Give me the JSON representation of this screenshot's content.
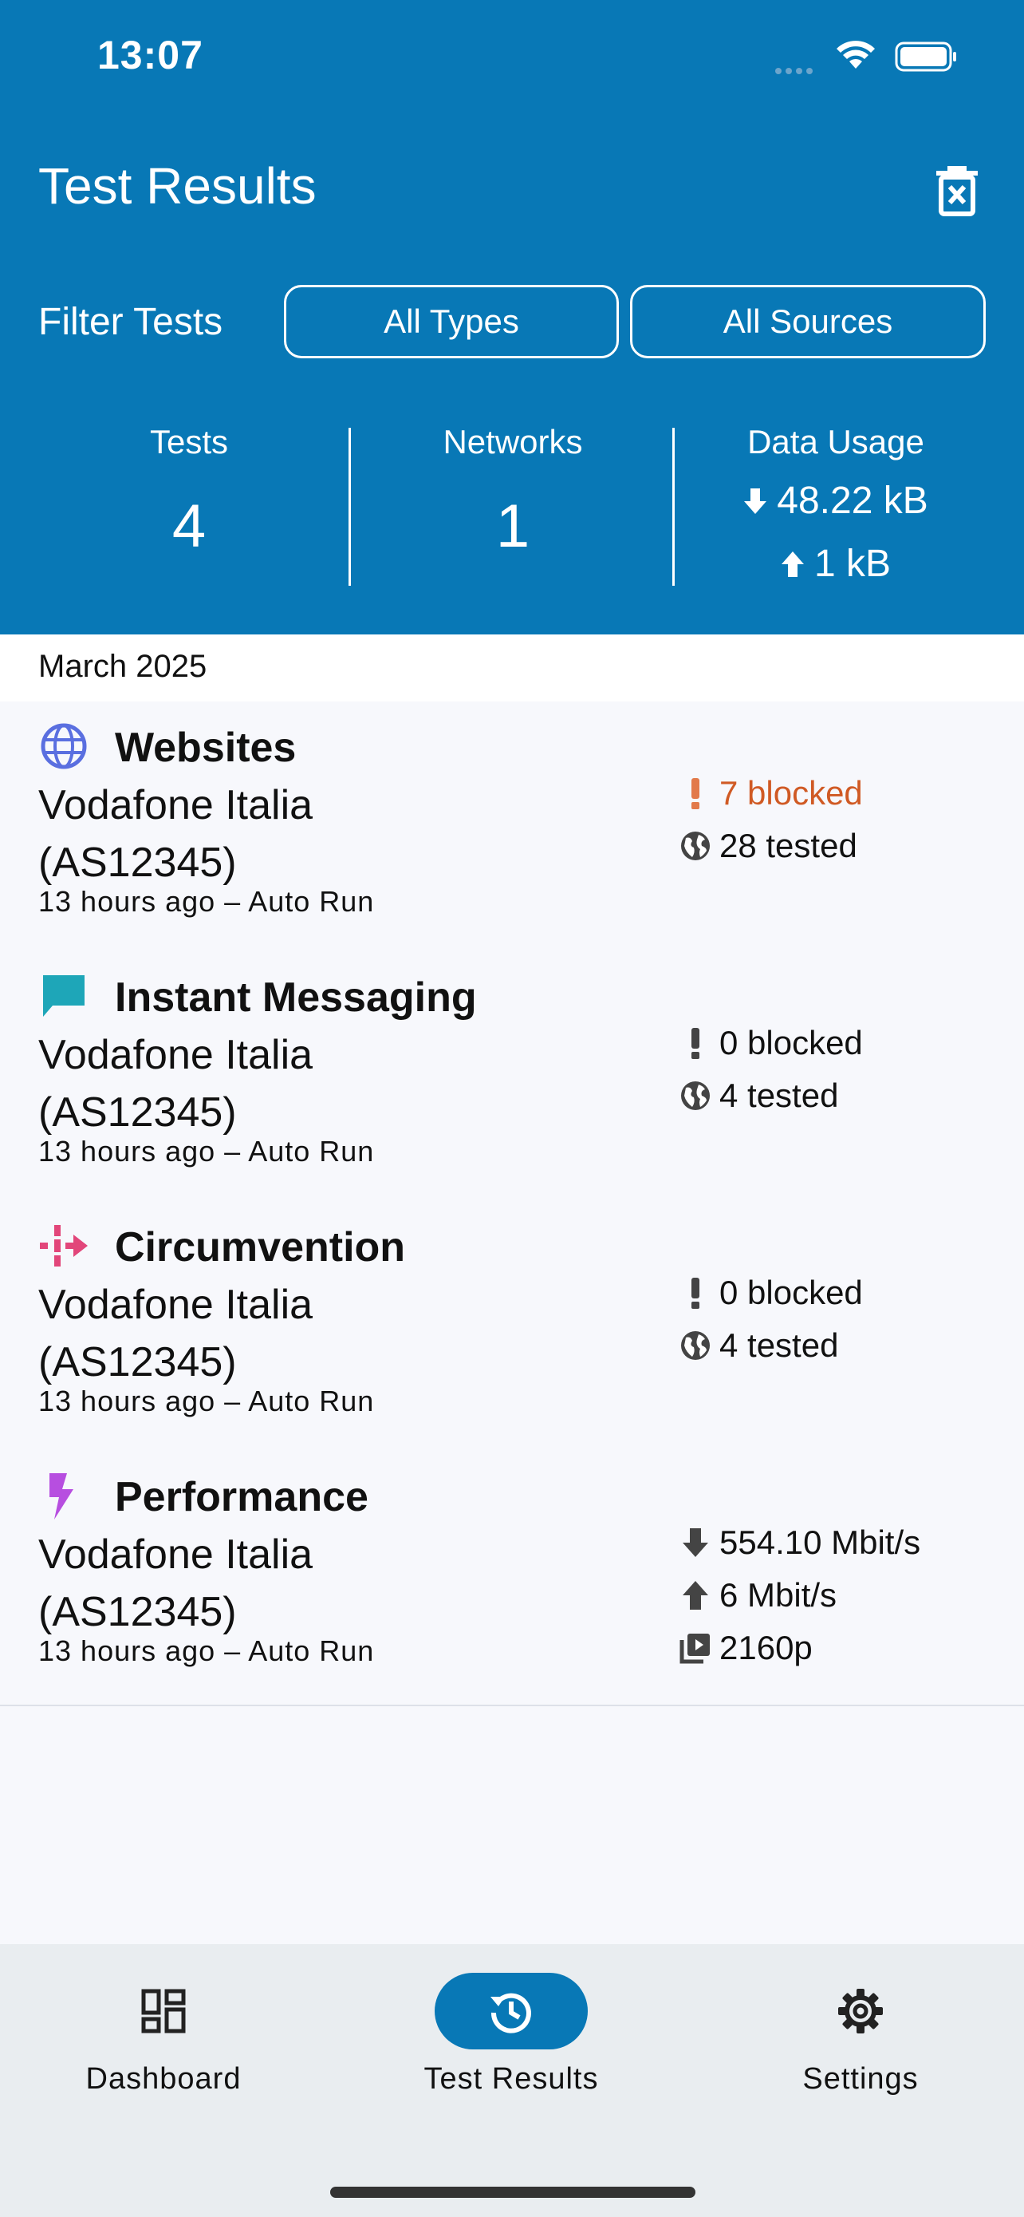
{
  "status_bar": {
    "time": "13:07"
  },
  "header": {
    "title": "Test Results",
    "filter_label": "Filter Tests",
    "filter_types": "All Types",
    "filter_sources": "All Sources",
    "stats": {
      "tests_label": "Tests",
      "tests_value": "4",
      "networks_label": "Networks",
      "networks_value": "1",
      "usage_label": "Data Usage",
      "usage_down": "48.22 kB",
      "usage_up": "1 kB"
    }
  },
  "month": "March 2025",
  "results": [
    {
      "title": "Websites",
      "icon": "globe-icon",
      "network_line1": "Vodafone Italia",
      "network_line2": "(AS12345)",
      "meta": "13 hours ago – Auto Run",
      "blocked": "7 blocked",
      "tested": "28 tested",
      "blocked_color": "#d05a24"
    },
    {
      "title": "Instant Messaging",
      "icon": "chat-icon",
      "network_line1": "Vodafone Italia",
      "network_line2": "(AS12345)",
      "meta": "13 hours ago – Auto Run",
      "blocked": "0 blocked",
      "tested": "4 tested"
    },
    {
      "title": "Circumvention",
      "icon": "circumvention-icon",
      "network_line1": "Vodafone Italia",
      "network_line2": "(AS12345)",
      "meta": "13 hours ago – Auto Run",
      "blocked": "0 blocked",
      "tested": "4 tested"
    },
    {
      "title": "Performance",
      "icon": "lightning-icon",
      "network_line1": "Vodafone Italia",
      "network_line2": "(AS12345)",
      "meta": "13 hours ago – Auto Run",
      "download": "554.10 Mbit/s",
      "upload": "6 Mbit/s",
      "video": "2160p"
    }
  ],
  "nav": {
    "dashboard": "Dashboard",
    "test_results": "Test Results",
    "settings": "Settings"
  },
  "colors": {
    "header_bg": "#0878b6",
    "websites_icon": "#5a6fe0",
    "messaging_icon": "#1ea6b8",
    "circumvention_icon": "#e2467a",
    "performance_icon": "#b74ee0",
    "blocked_warning": "#d05a24",
    "nav_bg": "#e9edf0"
  }
}
